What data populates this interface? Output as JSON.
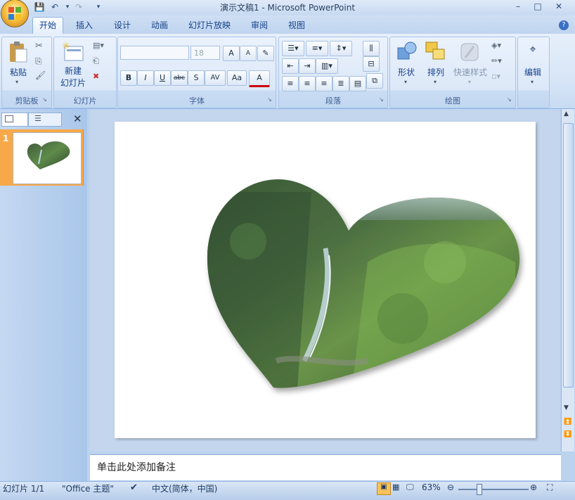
{
  "window": {
    "title": "演示文稿1 - Microsoft PowerPoint",
    "controls": [
      "minimize",
      "maximize",
      "close"
    ]
  },
  "tabs": [
    {
      "label": "开始",
      "active": true
    },
    {
      "label": "插入"
    },
    {
      "label": "设计"
    },
    {
      "label": "动画"
    },
    {
      "label": "幻灯片放映"
    },
    {
      "label": "审阅"
    },
    {
      "label": "视图"
    }
  ],
  "ribbon": {
    "clipboard": {
      "paste": "粘贴",
      "group": "剪贴板"
    },
    "slides": {
      "new_slide_line1": "新建",
      "new_slide_line2": "幻灯片",
      "group": "幻灯片"
    },
    "font": {
      "font_name": "",
      "font_size": "18",
      "group": "字体",
      "bold": "B",
      "italic": "I",
      "underline": "U",
      "strike": "abc",
      "shadow": "S",
      "spacing": "AV",
      "case": "Aa",
      "color": "A",
      "grow": "A",
      "shrink": "A"
    },
    "paragraph": {
      "group": "段落"
    },
    "drawing": {
      "shapes": "形状",
      "arrange": "排列",
      "quick_styles": "快速样式",
      "group": "绘图"
    },
    "editing": {
      "label": "编辑"
    }
  },
  "left_panel": {
    "slide_number": "1"
  },
  "notes": {
    "placeholder": "单击此处添加备注"
  },
  "status": {
    "slide": "幻灯片 1/1",
    "theme": "\"Office 主题\"",
    "language": "中文(简体，中国)",
    "zoom": "63%"
  },
  "colors": {
    "accent": "#f7a94a",
    "ribbon": "#dce8f8"
  }
}
